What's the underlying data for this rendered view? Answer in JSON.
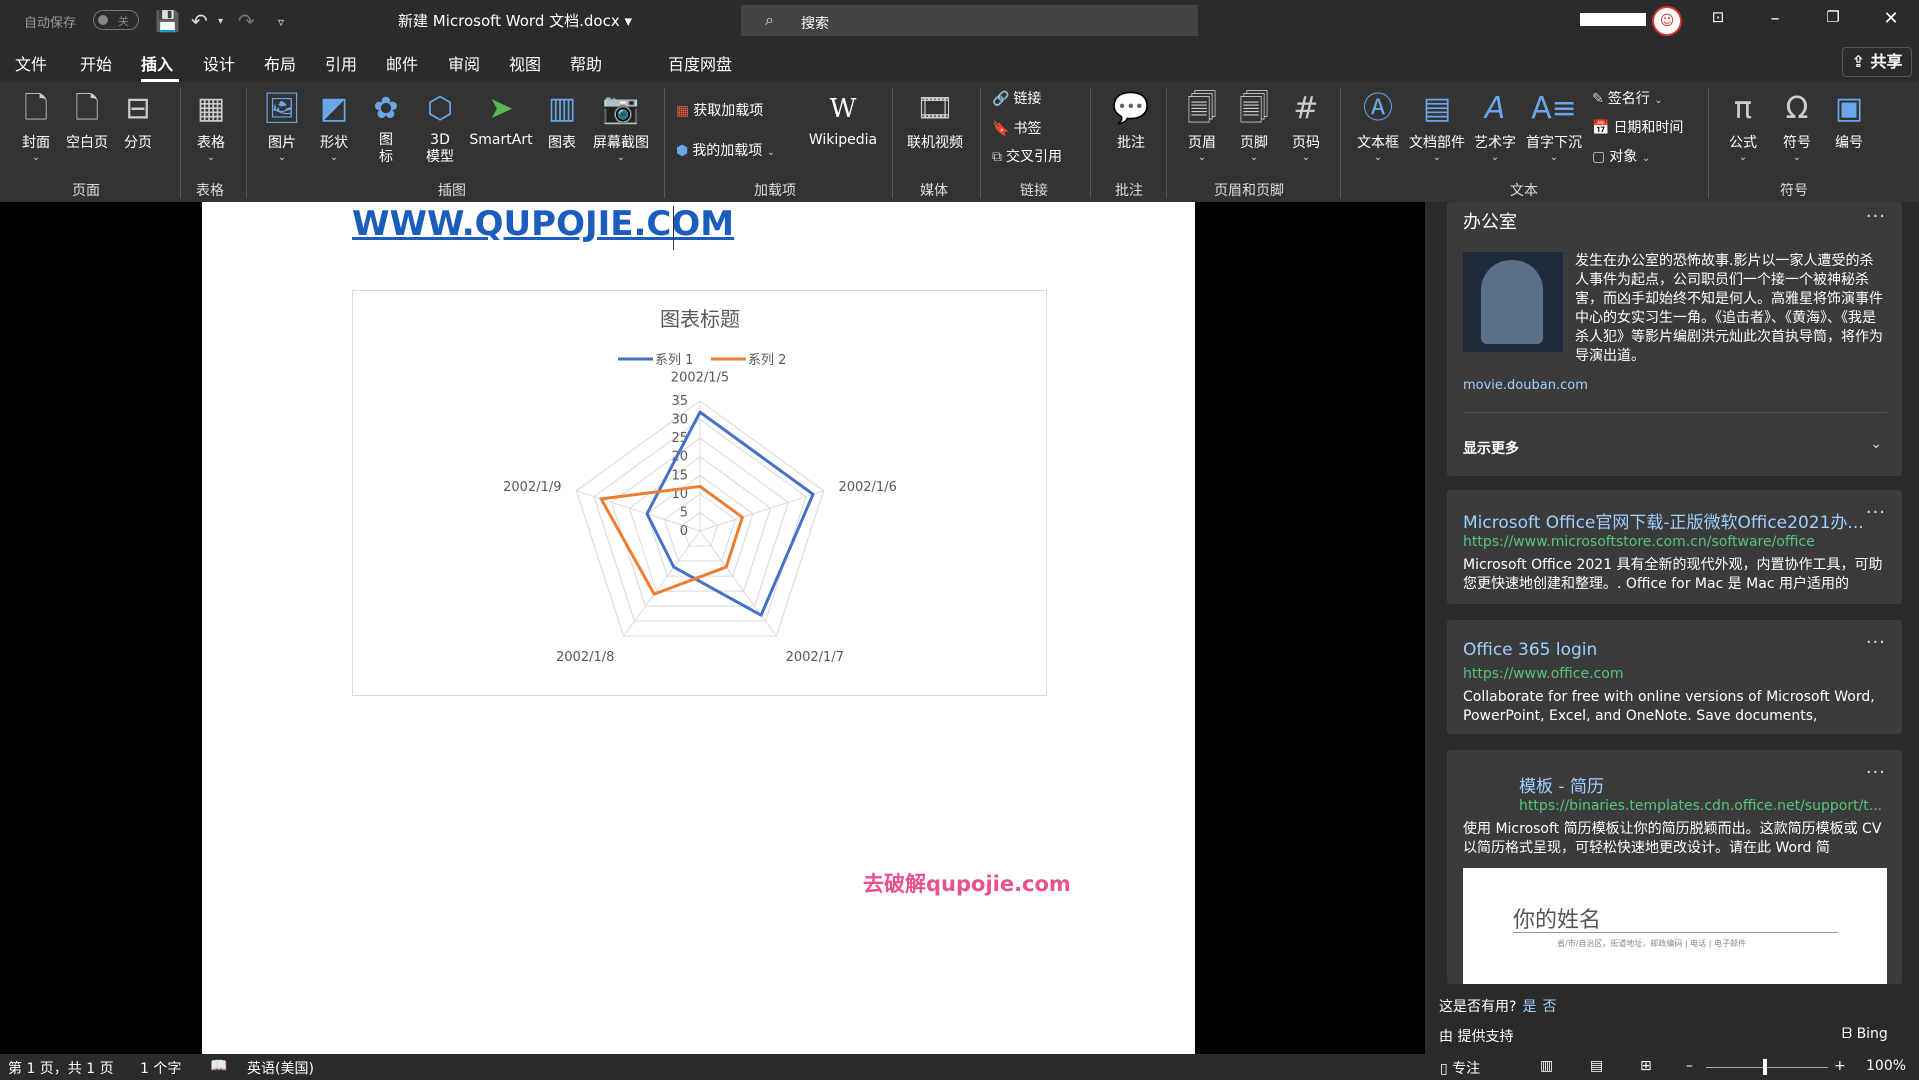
{
  "titlebar": {
    "autosave_label": "自动保存",
    "autosave_state": "关",
    "doc_title": "新建 Microsoft Word 文档.docx",
    "search_placeholder": "搜索"
  },
  "menu": {
    "items": [
      "文件",
      "开始",
      "插入",
      "设计",
      "布局",
      "引用",
      "邮件",
      "审阅",
      "视图",
      "帮助",
      "百度网盘"
    ],
    "share": "共享"
  },
  "ribbon": {
    "page_group": {
      "label": "页面",
      "buttons": [
        "封面",
        "空白页",
        "分页"
      ]
    },
    "table_group": {
      "label": "表格",
      "buttons": [
        "表格"
      ]
    },
    "illustration_group": {
      "label": "插图",
      "buttons": [
        "图片",
        "形状",
        "图标",
        "3D模型",
        "SmartArt",
        "图表",
        "屏幕截图"
      ]
    },
    "addins_group": {
      "label": "加载项",
      "get": "获取加载项",
      "mine": "我的加载项",
      "wikipedia": "Wikipedia"
    },
    "media_group": {
      "label": "媒体",
      "online_video": "联机视频"
    },
    "links_group": {
      "label": "链接",
      "link": "链接",
      "bookmark": "书签",
      "crossref": "交叉引用"
    },
    "comment_group": {
      "label": "批注",
      "comment": "批注"
    },
    "header_group": {
      "label": "页眉和页脚",
      "header": "页眉",
      "footer": "页脚",
      "pagenum": "页码"
    },
    "text_group": {
      "label": "文本",
      "textbox": "文本框",
      "quickparts": "文档部件",
      "wordart": "艺术字",
      "dropcap": "首字下沉",
      "signature": "签名行",
      "datetime": "日期和时间",
      "object": "对象"
    },
    "symbol_group": {
      "label": "符号",
      "equation": "公式",
      "symbol": "符号",
      "number": "编号"
    }
  },
  "document": {
    "link_text": "WWW.QUPOJIE.COM",
    "watermark": "去破解qupojie.com"
  },
  "chart_data": {
    "type": "radar",
    "title": "图表标题",
    "categories": [
      "2002/1/5",
      "2002/1/6",
      "2002/1/7",
      "2002/1/8",
      "2002/1/9"
    ],
    "series": [
      {
        "name": "系列 1",
        "values": [
          32,
          32,
          28,
          12,
          15
        ],
        "color": "#4472c4"
      },
      {
        "name": "系列 2",
        "values": [
          12,
          12,
          12,
          21,
          28
        ],
        "color": "#ed7d31"
      }
    ],
    "rlim": [
      0,
      35
    ],
    "ticks": [
      "0",
      "5",
      "10",
      "15",
      "20",
      "25",
      "30",
      "35"
    ],
    "legend": "top"
  },
  "pane": {
    "card1": {
      "title": "办公室",
      "desc": "发生在办公室的恐怖故事.影片以一家人遭受的杀人事件为起点，公司职员们一个接一个被神秘杀害，而凶手却始终不知是何人。高雅星将饰演事件中心的女实习生一角。《追击者》、《黄海》、《我是杀人犯》等影片编剧洪元灿此次首执导筒，将作为导演出道。",
      "source": "movie.douban.com",
      "more": "显示更多"
    },
    "card2": {
      "title": "Microsoft Office官网下载-正版微软Office2021办...",
      "url": "https://www.microsoftstore.com.cn/software/office",
      "desc": "Microsoft Office 2021 具有全新的现代外观，内置协作工具，可助您更快速地创建和整理。. Office for Mac 是 Mac 用户适用的"
    },
    "card3": {
      "title": "Office 365 login",
      "url": "https://www.office.com",
      "desc": "Collaborate for free with online versions of Microsoft Word, PowerPoint, Excel, and OneNote. Save documents,"
    },
    "card4": {
      "title": "模板 - 简历",
      "url": "https://binaries.templates.cdn.office.net/support/t...",
      "desc": "使用 Microsoft 简历模板让你的简历脱颖而出。这款简历模板或 CV 以简历格式呈现，可轻松快速地更改设计。请在此 Word 简",
      "preview_name": "你的姓名",
      "preview_sub": "省/市/自治区，街道地址，邮政编码 | 电话 | 电子邮件"
    },
    "useful": "这是否有用?",
    "yes": "是",
    "no": "否",
    "provided_by": "由 提供支持",
    "bing": "Bing"
  },
  "status": {
    "page": "第 1 页，共 1 页",
    "words": "1 个字",
    "language": "英语(美国)",
    "focus": "专注",
    "zoom": "100%"
  }
}
